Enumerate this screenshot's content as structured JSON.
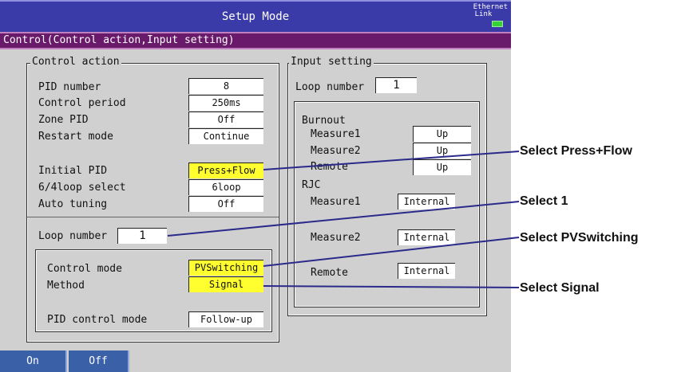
{
  "titlebar": {
    "title": "Setup Mode",
    "ethernet_label": "Ethernet",
    "link_label": "Link"
  },
  "subbar": {
    "label": "Control(Control action,Input setting)"
  },
  "control_action": {
    "title": "Control action",
    "rows": [
      {
        "label": "PID number",
        "value": "8"
      },
      {
        "label": "Control period",
        "value": "250ms"
      },
      {
        "label": "Zone PID",
        "value": "Off"
      },
      {
        "label": "Restart mode",
        "value": "Continue"
      },
      {
        "label": "Initial PID",
        "value": "Press+Flow"
      },
      {
        "label": "6/4loop select",
        "value": "6loop"
      },
      {
        "label": "Auto tuning",
        "value": "Off"
      }
    ],
    "loop_number_label": "Loop number",
    "loop_number_value": "1",
    "loop_rows": [
      {
        "label": "Control mode",
        "value": "PVSwitching"
      },
      {
        "label": "Method",
        "value": "Signal"
      },
      {
        "label": "PID control mode",
        "value": "Follow-up"
      }
    ]
  },
  "input_setting": {
    "title": "Input setting",
    "loop_number_label": "Loop number",
    "loop_number_value": "1",
    "burnout_label": "Burnout",
    "burnout_rows": [
      {
        "label": "Measure1",
        "value": "Up"
      },
      {
        "label": "Measure2",
        "value": "Up"
      },
      {
        "label": "Remote",
        "value": "Up"
      }
    ],
    "rjc_label": "RJC",
    "rjc_rows": [
      {
        "label": "Measure1",
        "value": "Internal"
      },
      {
        "label": "Measure2",
        "value": "Internal"
      },
      {
        "label": "Remote",
        "value": "Internal"
      }
    ]
  },
  "softkeys": [
    {
      "label": "On"
    },
    {
      "label": "Off"
    }
  ],
  "callouts": [
    {
      "text": "Select Press+Flow"
    },
    {
      "text": "Select 1"
    },
    {
      "text": "Select PVSwitching"
    },
    {
      "text": "Select Signal"
    }
  ],
  "colors": {
    "titlebar": "#3a3aa8",
    "subbar": "#6a1a6a",
    "highlight": "#ffff30",
    "softkey": "#3a60a8",
    "callout_line": "#2a2a8a",
    "link_led": "#35d335"
  }
}
